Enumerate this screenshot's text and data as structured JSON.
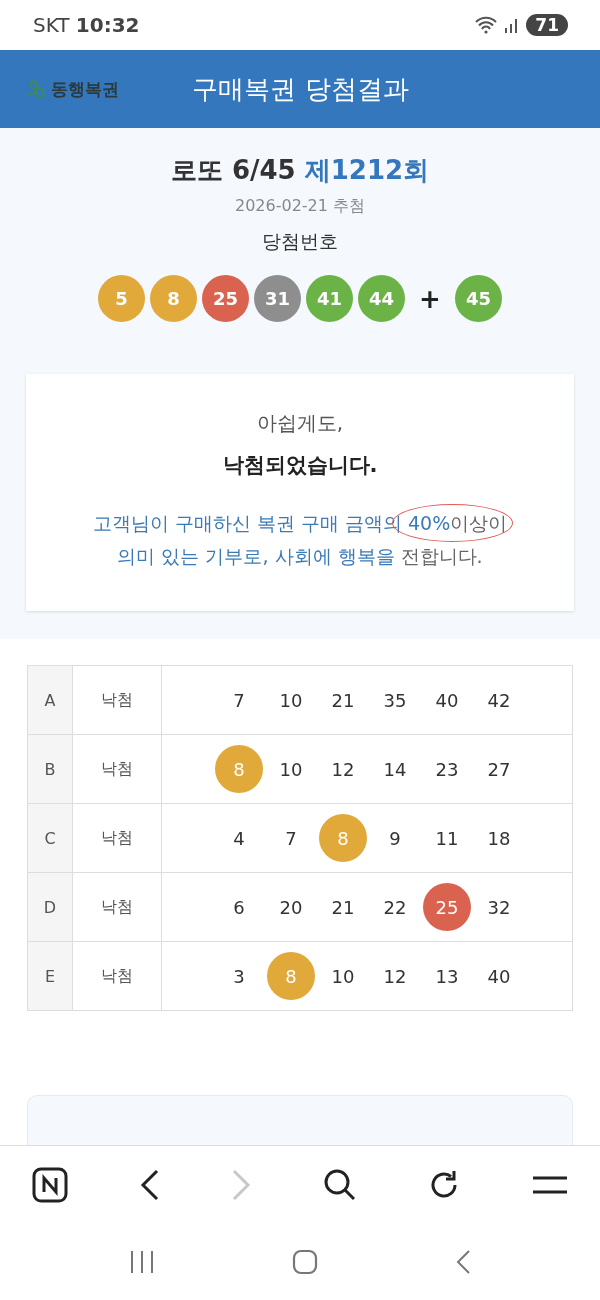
{
  "status_bar": {
    "carrier": "SKT",
    "time": "10:32",
    "battery": "71"
  },
  "header": {
    "logo_text": "동행복권",
    "title": "구매복권 당첨결과"
  },
  "draw": {
    "game": "로또 6/45",
    "round": "제1212회",
    "date": "2026-02-21 추첨",
    "label": "당첨번호",
    "plus": "+",
    "balls": [
      {
        "number": "5",
        "color": "#e0a93a"
      },
      {
        "number": "8",
        "color": "#e0a93a"
      },
      {
        "number": "25",
        "color": "#d9634f"
      },
      {
        "number": "31",
        "color": "#8e8e8e"
      },
      {
        "number": "41",
        "color": "#6cb347"
      },
      {
        "number": "44",
        "color": "#6cb347"
      }
    ],
    "bonus": {
      "number": "45",
      "color": "#6cb347"
    }
  },
  "result_card": {
    "intro": "아쉽게도,",
    "headline": "낙첨되었습니다.",
    "message_lines": [
      [
        {
          "text": "고객님이 구매하신 복권 구매 금액의 ",
          "color": "#3b7ab5"
        },
        {
          "text": "40%",
          "color": "#3b7ab5",
          "circled": true
        },
        {
          "text": "이상이",
          "color": "#666666",
          "circled": true
        }
      ],
      [
        {
          "text": "의미 있는 기부로, 사회에 행복을 ",
          "color": "#3b7ab5"
        },
        {
          "text": "전합니다.",
          "color": "#666666"
        }
      ]
    ]
  },
  "tickets": [
    {
      "label": "A",
      "result": "낙첨",
      "numbers": [
        {
          "n": "7",
          "matched": false
        },
        {
          "n": "10",
          "matched": false
        },
        {
          "n": "21",
          "matched": false
        },
        {
          "n": "35",
          "matched": false
        },
        {
          "n": "40",
          "matched": false
        },
        {
          "n": "42",
          "matched": false
        }
      ]
    },
    {
      "label": "B",
      "result": "낙첨",
      "numbers": [
        {
          "n": "8",
          "matched": true,
          "color": "#e0a93a"
        },
        {
          "n": "10",
          "matched": false
        },
        {
          "n": "12",
          "matched": false
        },
        {
          "n": "14",
          "matched": false
        },
        {
          "n": "23",
          "matched": false
        },
        {
          "n": "27",
          "matched": false
        }
      ]
    },
    {
      "label": "C",
      "result": "낙첨",
      "numbers": [
        {
          "n": "4",
          "matched": false
        },
        {
          "n": "7",
          "matched": false
        },
        {
          "n": "8",
          "matched": true,
          "color": "#e0a93a"
        },
        {
          "n": "9",
          "matched": false
        },
        {
          "n": "11",
          "matched": false
        },
        {
          "n": "18",
          "matched": false
        }
      ]
    },
    {
      "label": "D",
      "result": "낙첨",
      "numbers": [
        {
          "n": "6",
          "matched": false
        },
        {
          "n": "20",
          "matched": false
        },
        {
          "n": "21",
          "matched": false
        },
        {
          "n": "22",
          "matched": false
        },
        {
          "n": "25",
          "matched": true,
          "color": "#d9634f"
        },
        {
          "n": "32",
          "matched": false
        }
      ]
    },
    {
      "label": "E",
      "result": "낙첨",
      "numbers": [
        {
          "n": "3",
          "matched": false
        },
        {
          "n": "8",
          "matched": true,
          "color": "#e0a93a"
        },
        {
          "n": "10",
          "matched": false
        },
        {
          "n": "12",
          "matched": false
        },
        {
          "n": "13",
          "matched": false
        },
        {
          "n": "40",
          "matched": false
        }
      ]
    }
  ],
  "browser_toolbar": {
    "forward_disabled": true
  }
}
